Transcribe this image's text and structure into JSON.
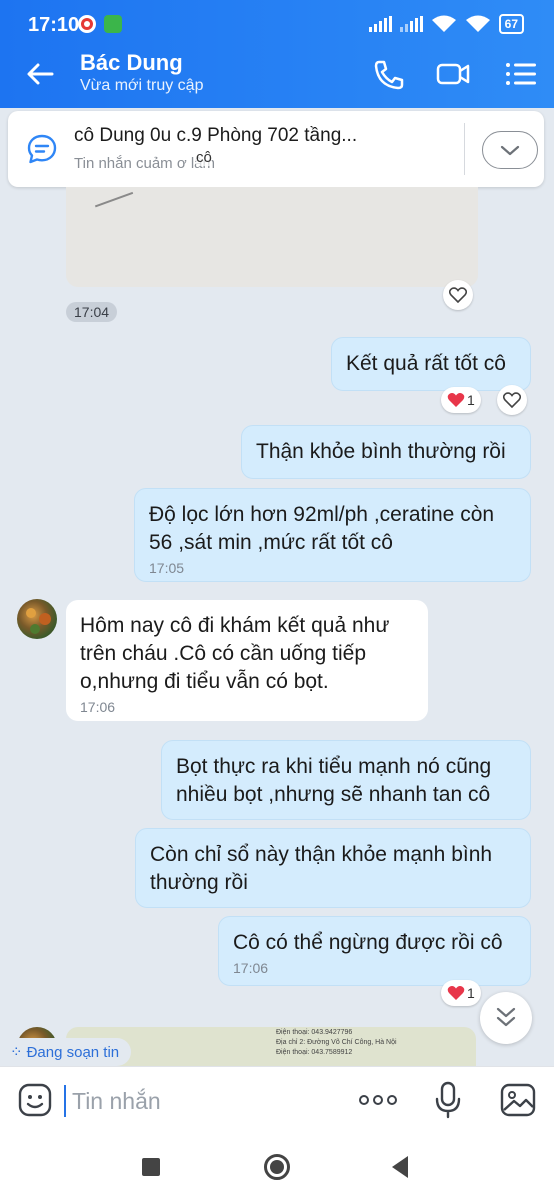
{
  "status_bar": {
    "time": "17:10",
    "battery": "67"
  },
  "header": {
    "contact_name": "Bác Dung",
    "presence": "Vừa mới truy cập",
    "call_icon": "phone-icon",
    "video_icon": "video-icon",
    "menu_icon": "list-menu-icon"
  },
  "pinned": {
    "text": "cô Dung 0u        c.9 Phòng 702 tầng...",
    "sub": "Tin nhắn cuảm ơ  lâm",
    "overlay": "cô"
  },
  "messages": [
    {
      "id": "img1-time",
      "time": "17:04"
    },
    {
      "id": "m1",
      "side": "me",
      "text": "Kết quả rất tốt cô",
      "reaction_count": "1"
    },
    {
      "id": "m2",
      "side": "me",
      "text": "Thận khỏe bình thường rồi"
    },
    {
      "id": "m3",
      "side": "me",
      "line1": "Độ lọc lớn hơn 92ml/ph ,ceratine còn",
      "line2": "56 ,sát min ,mức rất tốt cô",
      "time": "17:05"
    },
    {
      "id": "m4",
      "side": "them",
      "line1": "Hôm nay cô đi khám kết quả như",
      "line2": "trên cháu .Cô có cần uống tiếp",
      "line3": "o,nhưng đi tiểu vẫn có bọt.",
      "time": "17:06"
    },
    {
      "id": "m5",
      "side": "me",
      "line1": "Bọt thực ra khi tiểu mạnh nó cũng",
      "line2": "nhiều bọt ,nhưng sẽ nhanh tan cô"
    },
    {
      "id": "m6",
      "side": "me",
      "line1": "Còn chỉ sổ này thận khỏe mạnh bình",
      "line2": "thường rồi"
    },
    {
      "id": "m7",
      "side": "me",
      "text": "Cô có thể ngừng được rồi cô",
      "time": "17:06",
      "reaction_count": "1"
    }
  ],
  "image_bottom_text": {
    "l1": "Điện thoại: 043.9427796",
    "l2": "Địa chỉ 2: Đường Võ Chí Công, Hà Nội",
    "l3": "Điện thoại: 043.7589912"
  },
  "typing_indicator": "Đang soạn tin",
  "composer": {
    "placeholder": "Tin nhắn"
  },
  "colors": {
    "header_blue": "#1d74f1",
    "my_bubble": "#d4ecfd",
    "their_bubble": "#ffffff",
    "background": "#e3e9f0",
    "heart_red": "#e8364a"
  }
}
